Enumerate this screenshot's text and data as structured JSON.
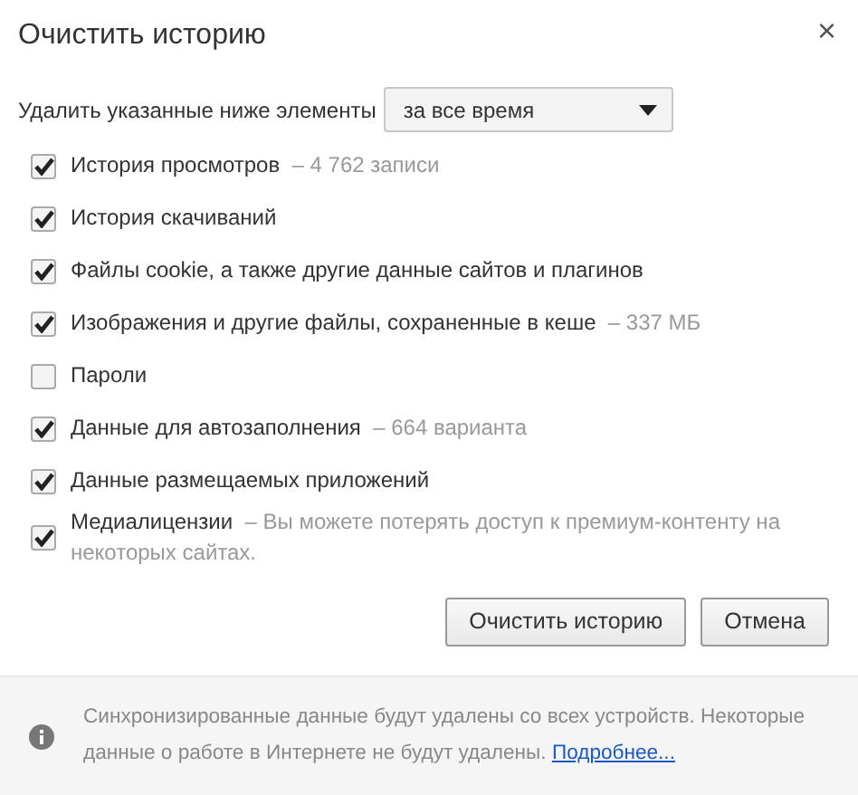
{
  "dialog": {
    "title": "Очистить историю",
    "close": "×"
  },
  "range": {
    "label": "Удалить указанные ниже элементы",
    "value": "за все время"
  },
  "items": [
    {
      "label": "История просмотров",
      "detail": "– 4 762 записи",
      "checked": true
    },
    {
      "label": "История скачиваний",
      "checked": true
    },
    {
      "label": "Файлы cookie, а также другие данные сайтов и плагинов",
      "checked": true
    },
    {
      "label": "Изображения и другие файлы, сохраненные в кеше",
      "detail": "– 337 МБ",
      "checked": true
    },
    {
      "label": "Пароли",
      "checked": false
    },
    {
      "label": "Данные для автозаполнения",
      "detail": "– 664 варианта",
      "checked": true
    },
    {
      "label": "Данные размещаемых приложений",
      "checked": true
    },
    {
      "label": "Медиалицензии",
      "detail": "– Вы можете потерять доступ к премиум-контенту на некоторых сайтах.",
      "checked": true
    }
  ],
  "buttons": [
    "Очистить историю",
    "Отмена"
  ],
  "footer": {
    "text": "Синхронизированные данные будут удалены со всех устройств. Некоторые данные о работе в Интернете не будут удалены.",
    "link": "Подробнее..."
  }
}
